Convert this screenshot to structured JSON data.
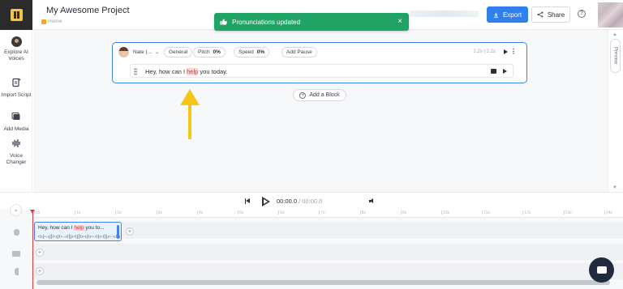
{
  "header": {
    "project_title": "My Awesome Project",
    "breadcrumb": "Home",
    "export_label": "Export",
    "share_label": "Share"
  },
  "toast": {
    "message": "Pronunciations updated",
    "close_glyph": "×"
  },
  "sidebar": {
    "items": [
      {
        "label": "Explore AI Voices",
        "icon": "voice-avatar-icon"
      },
      {
        "label": "Import Script",
        "icon": "import-icon"
      },
      {
        "label": "Add Media",
        "icon": "media-icon"
      },
      {
        "label": "Voice Changer",
        "icon": "voice-changer-icon"
      }
    ]
  },
  "block": {
    "voice_name": "Nate (...",
    "style": "General",
    "pitch_label": "Pitch",
    "pitch_value": "0%",
    "speed_label": "Speed",
    "speed_value": "0%",
    "add_pause": "Add Pause",
    "duration": "2.2s | 2.2s",
    "text_before": "Hey, how can I ",
    "text_highlight": "help",
    "text_after": " you today."
  },
  "add_block_label": "Add a Block",
  "preview_tab": "Preview",
  "player": {
    "current_time": "00:00.0",
    "separator": " / ",
    "total_time": "00:00.0"
  },
  "timeline": {
    "ticks": [
      "0s",
      "1s",
      "2s",
      "3s",
      "4s",
      "5s",
      "6s",
      "7s",
      "8s",
      "9s",
      "10s",
      "11s",
      "12s",
      "13s",
      "14s"
    ],
    "clip_text_before": "Hey, how can I ",
    "clip_text_highlight": "help",
    "clip_text_after": " you to..."
  },
  "colors": {
    "accent": "#2f80ed",
    "toast": "#21a366",
    "highlight": "#d43a3a",
    "arrow": "#f5c518"
  }
}
